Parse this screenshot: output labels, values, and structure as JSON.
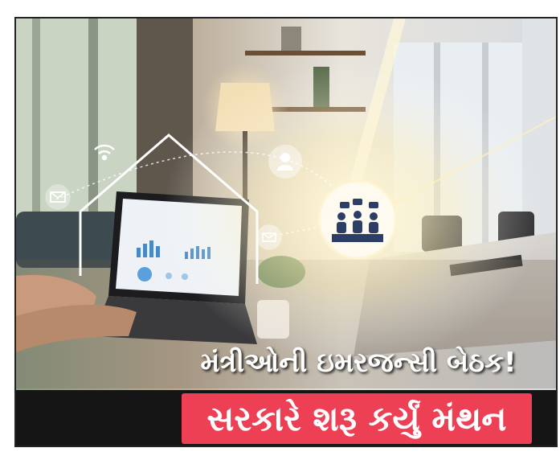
{
  "top_banner": {
    "text": ""
  },
  "headline": {
    "line1": "મંત્રીઓની ઇમરજન્સી બેઠક!",
    "line2": "સરકારે શરૂ કર્યું મંથન"
  },
  "colors": {
    "headline_band": "#ee4055",
    "top_banner_text": "#7a2aa8",
    "glow": "#fff3c8"
  },
  "icons": [
    "wifi-icon",
    "mail-icon",
    "user-icon",
    "meeting-icon",
    "house-outline-icon"
  ]
}
